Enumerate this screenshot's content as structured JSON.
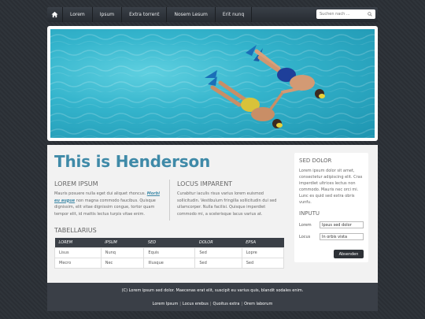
{
  "nav": {
    "items": [
      "Lorem",
      "Ipsum",
      "Extra torrent",
      "Nosem Lesum",
      "Erit nunq"
    ],
    "search_placeholder": "Suchen nach ..."
  },
  "main": {
    "title": "This is Henderson",
    "col1": {
      "heading": "Lorem ipsum",
      "text_before": "Mauris posuere nulla eget dui aliquet rhoncus. ",
      "link": "Morbi eu augue",
      "text_after": " non magna commodo faucibus. Quisque dignissim, elit vitae dignissim congue, tortor quam tempor elit, id mattis lectus turpis vitae enim."
    },
    "col2": {
      "heading": "Locus imparent",
      "text": "Curabitur iaculis risus varius lorem euismod sollicitudin. Vestibulum fringilla sollicitudin dui sed ullamcorper. Nulla facilisi. Quisque imperdiet commodo mi, a scelerisque lacus varius at."
    },
    "table": {
      "heading": "Tabellarius",
      "columns": [
        "Lorem",
        "Ipsum",
        "Sed",
        "Dolor",
        "Epsa"
      ],
      "rows": [
        [
          "Lisus",
          "Nunq",
          "Equis",
          "Sed",
          "Lopre"
        ],
        [
          "Mecro",
          "Nec",
          "Illusque",
          "Sed",
          "Sed"
        ]
      ]
    }
  },
  "sidebar": {
    "heading": "Sed dolor",
    "text": "Lorem ipsum dolor sit amet, consectetur adipiscing elit. Cras imperdiet ultrices lectus non commodo. Mauris nec orci mi. Lunc es quid sed extra obris vunfu.",
    "form_heading": "Inputu",
    "name_label": "Lorem",
    "name_value": "Ipsus sed dolor",
    "locus_label": "Locus",
    "locus_value": "In orbis vista",
    "submit_label": "Absenden"
  },
  "footer": {
    "copyright": "(C) Lorem ipsum sed dolor. Maecenas erat elit, suscipit eu varius quis, blandit sodales enim.",
    "links": [
      "Lorem Ipsum",
      "Locus erebus",
      "Quoitus extra",
      "Orem laborum"
    ]
  },
  "colors": {
    "accent": "#3f8aa8",
    "nav_bg": "#2d3238",
    "page_bg": "#2b3036",
    "footer_bg": "#3a3f47"
  }
}
